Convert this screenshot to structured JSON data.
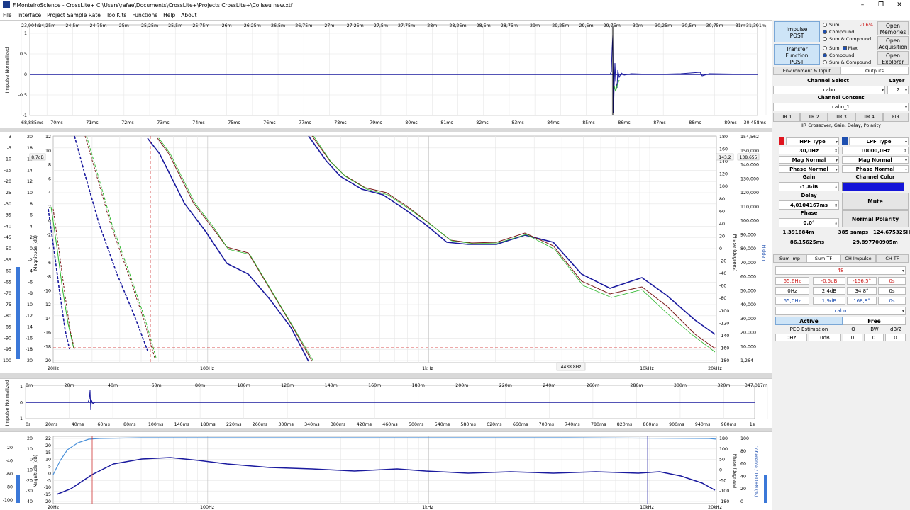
{
  "window": {
    "title": "F.MonteiroScience - CrossLite+ C:\\Users\\rafae\\Documents\\CrossLite+\\Projects CrossLite+\\Coliseu new.xtf",
    "minimize": "–",
    "maximize": "❐",
    "close": "✕"
  },
  "menu": [
    "File",
    "Interface",
    "Project Sample Rate",
    "ToolKits",
    "Functions",
    "Help",
    "About"
  ],
  "impulse_top": {
    "ylabel": "Impulse Normalized",
    "top_ticks": [
      "23,904m",
      "24,25m",
      "24,5m",
      "24,75m",
      "25m",
      "25,25m",
      "25,5m",
      "25,75m",
      "26m",
      "26,25m",
      "26,5m",
      "26,75m",
      "27m",
      "27,25m",
      "27,5m",
      "27,75m",
      "28m",
      "28,25m",
      "28,5m",
      "28,75m",
      "29m",
      "29,25m",
      "29,5m",
      "29,75m",
      "30m",
      "30,25m",
      "30,5m",
      "30,75m",
      "31m",
      "31,391m"
    ],
    "bottom_ticks": [
      "68,885ms",
      "70ms",
      "71ms",
      "72ms",
      "73ms",
      "74ms",
      "75ms",
      "76ms",
      "77ms",
      "78ms",
      "79ms",
      "80ms",
      "81ms",
      "82ms",
      "83ms",
      "84ms",
      "85ms",
      "86ms",
      "87ms",
      "88ms",
      "89ms",
      "30,458ms"
    ],
    "yticks": [
      "1",
      "0,5",
      "0",
      "-0,5",
      "-1"
    ]
  },
  "tf_main": {
    "ylabel": "Magnitude (dB)",
    "rlabel": "Phase (degrees)",
    "hidden_label": "Hidden",
    "outer_left_ticks": [
      "-3",
      "-5",
      "-10",
      "-15",
      "-20",
      "-25",
      "-30",
      "-35",
      "-40",
      "-45",
      "-50",
      "-55",
      "-60",
      "-65",
      "-70",
      "-75",
      "-80",
      "-85",
      "-90",
      "-95",
      "-100"
    ],
    "left_ticks": [
      "20",
      "18",
      "16",
      "14",
      "12",
      "10",
      "8",
      "6",
      "4",
      "2",
      "0",
      "-2",
      "-4",
      "-6",
      "-8",
      "-10",
      "-12",
      "-14",
      "-16",
      "-18",
      "-20"
    ],
    "inner_left_ticks": [
      "12",
      "10",
      "8",
      "6",
      "4",
      "2",
      "0",
      "-2",
      "-4",
      "-6",
      "-8",
      "-10",
      "-12",
      "-14",
      "-16",
      "-18",
      "-20"
    ],
    "phase_ticks": [
      "180",
      "160",
      "140",
      "120",
      "100",
      "80",
      "60",
      "40",
      "20",
      "0",
      "-20",
      "-40",
      "-60",
      "-80",
      "-100",
      "-120",
      "-140",
      "-160",
      "-180"
    ],
    "right_ticks": [
      "154,562",
      "150,000",
      "140,000",
      "130,000",
      "120,000",
      "110,000",
      "100,000",
      "90,000",
      "80,000",
      "70,000",
      "60,000",
      "50,000",
      "40,000",
      "30,000",
      "20,000",
      "10,000",
      "1,264"
    ],
    "xticks": [
      "20Hz",
      "100Hz",
      "1kHz",
      "10kHz",
      "20kHz"
    ],
    "cursor_label_left": "8,7dB",
    "cursor_label_right1": "143,2",
    "cursor_label_right2": "138,655",
    "cursor_freq": "4438,8Hz"
  },
  "impulse_mid": {
    "ylabel": "Impulse Normalized",
    "top_ticks": [
      "0m",
      "20m",
      "40m",
      "60m",
      "80m",
      "100m",
      "120m",
      "140m",
      "160m",
      "180m",
      "200m",
      "220m",
      "240m",
      "260m",
      "280m",
      "300m",
      "320m",
      "347,017m"
    ],
    "bottom_ticks": [
      "0s",
      "20ms",
      "40ms",
      "60ms",
      "80ms",
      "100ms",
      "140ms",
      "180ms",
      "220ms",
      "260ms",
      "300ms",
      "340ms",
      "380ms",
      "420ms",
      "460ms",
      "500ms",
      "540ms",
      "580ms",
      "620ms",
      "660ms",
      "700ms",
      "740ms",
      "780ms",
      "820ms",
      "860ms",
      "900ms",
      "940ms",
      "980ms",
      "1s"
    ],
    "yticks": [
      "1",
      "0",
      "-1"
    ]
  },
  "tf_bottom": {
    "ylabel": "Magnitude (dB)",
    "rlabel": "Phase (degrees)",
    "coh_label": "Coherence / THD+N (%)",
    "outer_left_ticks": [
      "-20",
      "-40",
      "-60",
      "-80",
      "-100"
    ],
    "left_ticks": [
      "20",
      "10",
      "0",
      "-10",
      "-20",
      "-30",
      "-40"
    ],
    "mag_ticks": [
      "22",
      "20",
      "15",
      "10",
      "5",
      "0",
      "-5",
      "-10",
      "-15",
      "-20"
    ],
    "phase_ticks": [
      "180",
      "100",
      "50",
      "0",
      "-50",
      "-100",
      "-180"
    ],
    "coh_ticks": [
      "100",
      "80",
      "60",
      "40",
      "20",
      "0"
    ],
    "xticks": [
      "20Hz",
      "100Hz",
      "1kHz",
      "10kHz",
      "20kHz"
    ]
  },
  "panel": {
    "impulse_post": "Impulse\nPOST",
    "tf_post": "Transfer\nFunction\nPOST",
    "sum": "Sum",
    "compound": "Compound",
    "sum_compound": "Sum & Compound",
    "max": "Max",
    "percent": "-0,6%",
    "open_memories": "Open\nMemories",
    "open_acquisition": "Open\nAcquisition",
    "open_explorer": "Open\nExplorer",
    "tab_env": "Environment & Input",
    "tab_out": "Outputs",
    "channel_select": "Channel Select",
    "layer": "Layer",
    "channel_value": "cabo",
    "layer_value": "2",
    "channel_content": "Channel Content",
    "content_value": "cabo_1",
    "iir_tabs": [
      "IIR 1",
      "IIR 2",
      "IIR 3",
      "IIR 4",
      "FIR"
    ],
    "iir_title": "IIR Crossover, Gain, Delay, Polarity",
    "hpf_type": "HPF Type",
    "lpf_type": "LPF Type",
    "hpf_freq": "30,0Hz",
    "lpf_freq": "10000,0Hz",
    "mag_normal": "Mag Normal",
    "phase_normal": "Phase Normal",
    "gain": "Gain",
    "channel_color": "Channel Color",
    "gain_value": "-1,8dB",
    "delay": "Delay",
    "delay_value": "4,0104167ms",
    "mute": "Mute",
    "phase": "Phase",
    "phase_value": "0,0°",
    "normal_polarity": "Normal Polarity",
    "info1": "1,391684m",
    "info2": "385 samps",
    "info3": "124,675325Hz",
    "info4": "86,15625ms",
    "info5": "29,897700905m",
    "btabs": [
      "Sum Imp",
      "Sum TF",
      "CH Impulse",
      "CH TF"
    ],
    "sel48": "48",
    "row1": [
      "55,6Hz",
      "-0,5dB",
      "-156,5°",
      "0s"
    ],
    "row2": [
      "0Hz",
      "2,4dB",
      "34,8°",
      "0s"
    ],
    "row3": [
      "55,0Hz",
      "1,9dB",
      "168,8°",
      "0s"
    ],
    "cabo": "cabo",
    "active": "Active",
    "free": "Free",
    "peq": "PEQ Estimation",
    "q": "Q",
    "bw": "BW",
    "db2": "dB/2",
    "peq_vals": [
      "0Hz",
      "0dB",
      "0",
      "0",
      "0"
    ]
  },
  "colors": {
    "blue": "#1a1a9e",
    "red": "#cc1a1a",
    "green": "#2eb82e",
    "accent": "#1e4fb0"
  }
}
